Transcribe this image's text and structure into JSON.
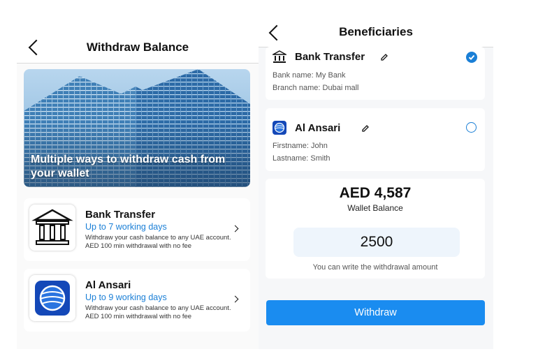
{
  "colors": {
    "accent": "#1a7fd6",
    "button": "#1a8cf0"
  },
  "left": {
    "title": "Withdraw Balance",
    "hero_text": "Multiple ways to withdraw cash from your wallet",
    "methods": [
      {
        "name": "Bank Transfer",
        "days": "Up to 7 working days",
        "desc": "Withdraw your cash balance to any UAE account. AED 100 min withdrawal with no fee",
        "icon": "bank-icon"
      },
      {
        "name": "Al Ansari",
        "days": "Up to 9 working days",
        "desc": "Withdraw your cash balance to any UAE account. AED 100 min withdrawal with no fee",
        "icon": "globe-icon"
      }
    ]
  },
  "right": {
    "title": "Beneficiaries",
    "beneficiaries": [
      {
        "name": "Bank Transfer",
        "line1": "Bank name: My Bank",
        "line2": "Branch name: Dubai mall",
        "selected": true
      },
      {
        "name": "Al Ansari",
        "line1": "Firstname: John",
        "line2": "Lastname: Smith",
        "selected": false
      }
    ],
    "balance": "AED 4,587",
    "balance_label": "Wallet Balance",
    "amount_value": "2500",
    "amount_hint": "You can write the withdrawal amount",
    "withdraw_label": "Withdraw"
  }
}
